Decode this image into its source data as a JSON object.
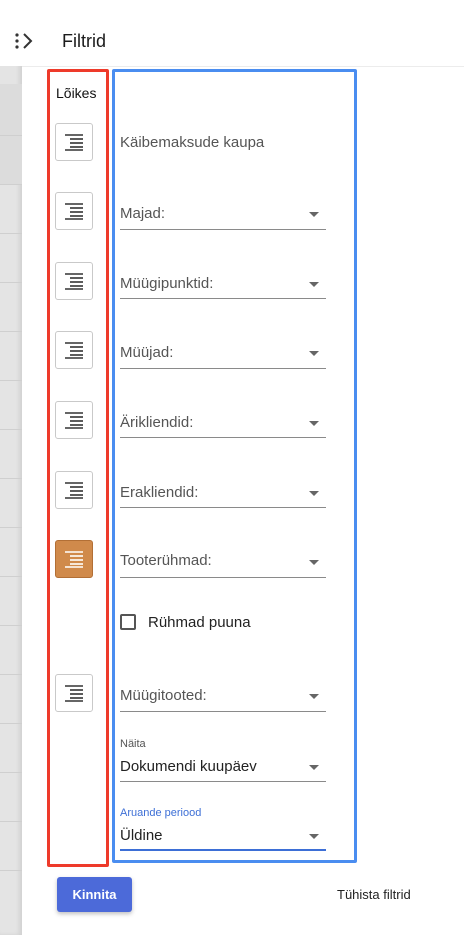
{
  "header": {
    "title": "Filtrid",
    "toggle_icon": "chevron-right-expand-icon"
  },
  "segments": {
    "label": "Lõikes",
    "icon": "align-right-lines-icon",
    "active_color": "#d08a4b",
    "buttons": [
      {
        "active": false
      },
      {
        "active": false
      },
      {
        "active": false
      },
      {
        "active": false
      },
      {
        "active": false
      },
      {
        "active": false
      },
      {
        "active": true
      },
      {
        "active": false
      }
    ]
  },
  "filters": {
    "by_vat": "Käibemaksude kaupa",
    "houses": "Majad:",
    "sale_points": "Müügipunktid:",
    "sellers": "Müüjad:",
    "business_clients": "Ärikliendid:",
    "private_clients": "Erakliendid:",
    "product_groups": "Tooterühmad:",
    "groups_as_tree": "Rühmad puuna",
    "sale_products": "Müügitooted:",
    "show_label": "Näita",
    "show_value": "Dokumendi kuupäev",
    "period_label": "Aruande periood",
    "period_value": "Üldine"
  },
  "footer": {
    "apply": "Kinnita",
    "clear": "Tühista filtrid",
    "apply_color": "#4c6ad9"
  },
  "annotation_colors": {
    "red": "#ee3a2a",
    "blue": "#4a8df0"
  }
}
